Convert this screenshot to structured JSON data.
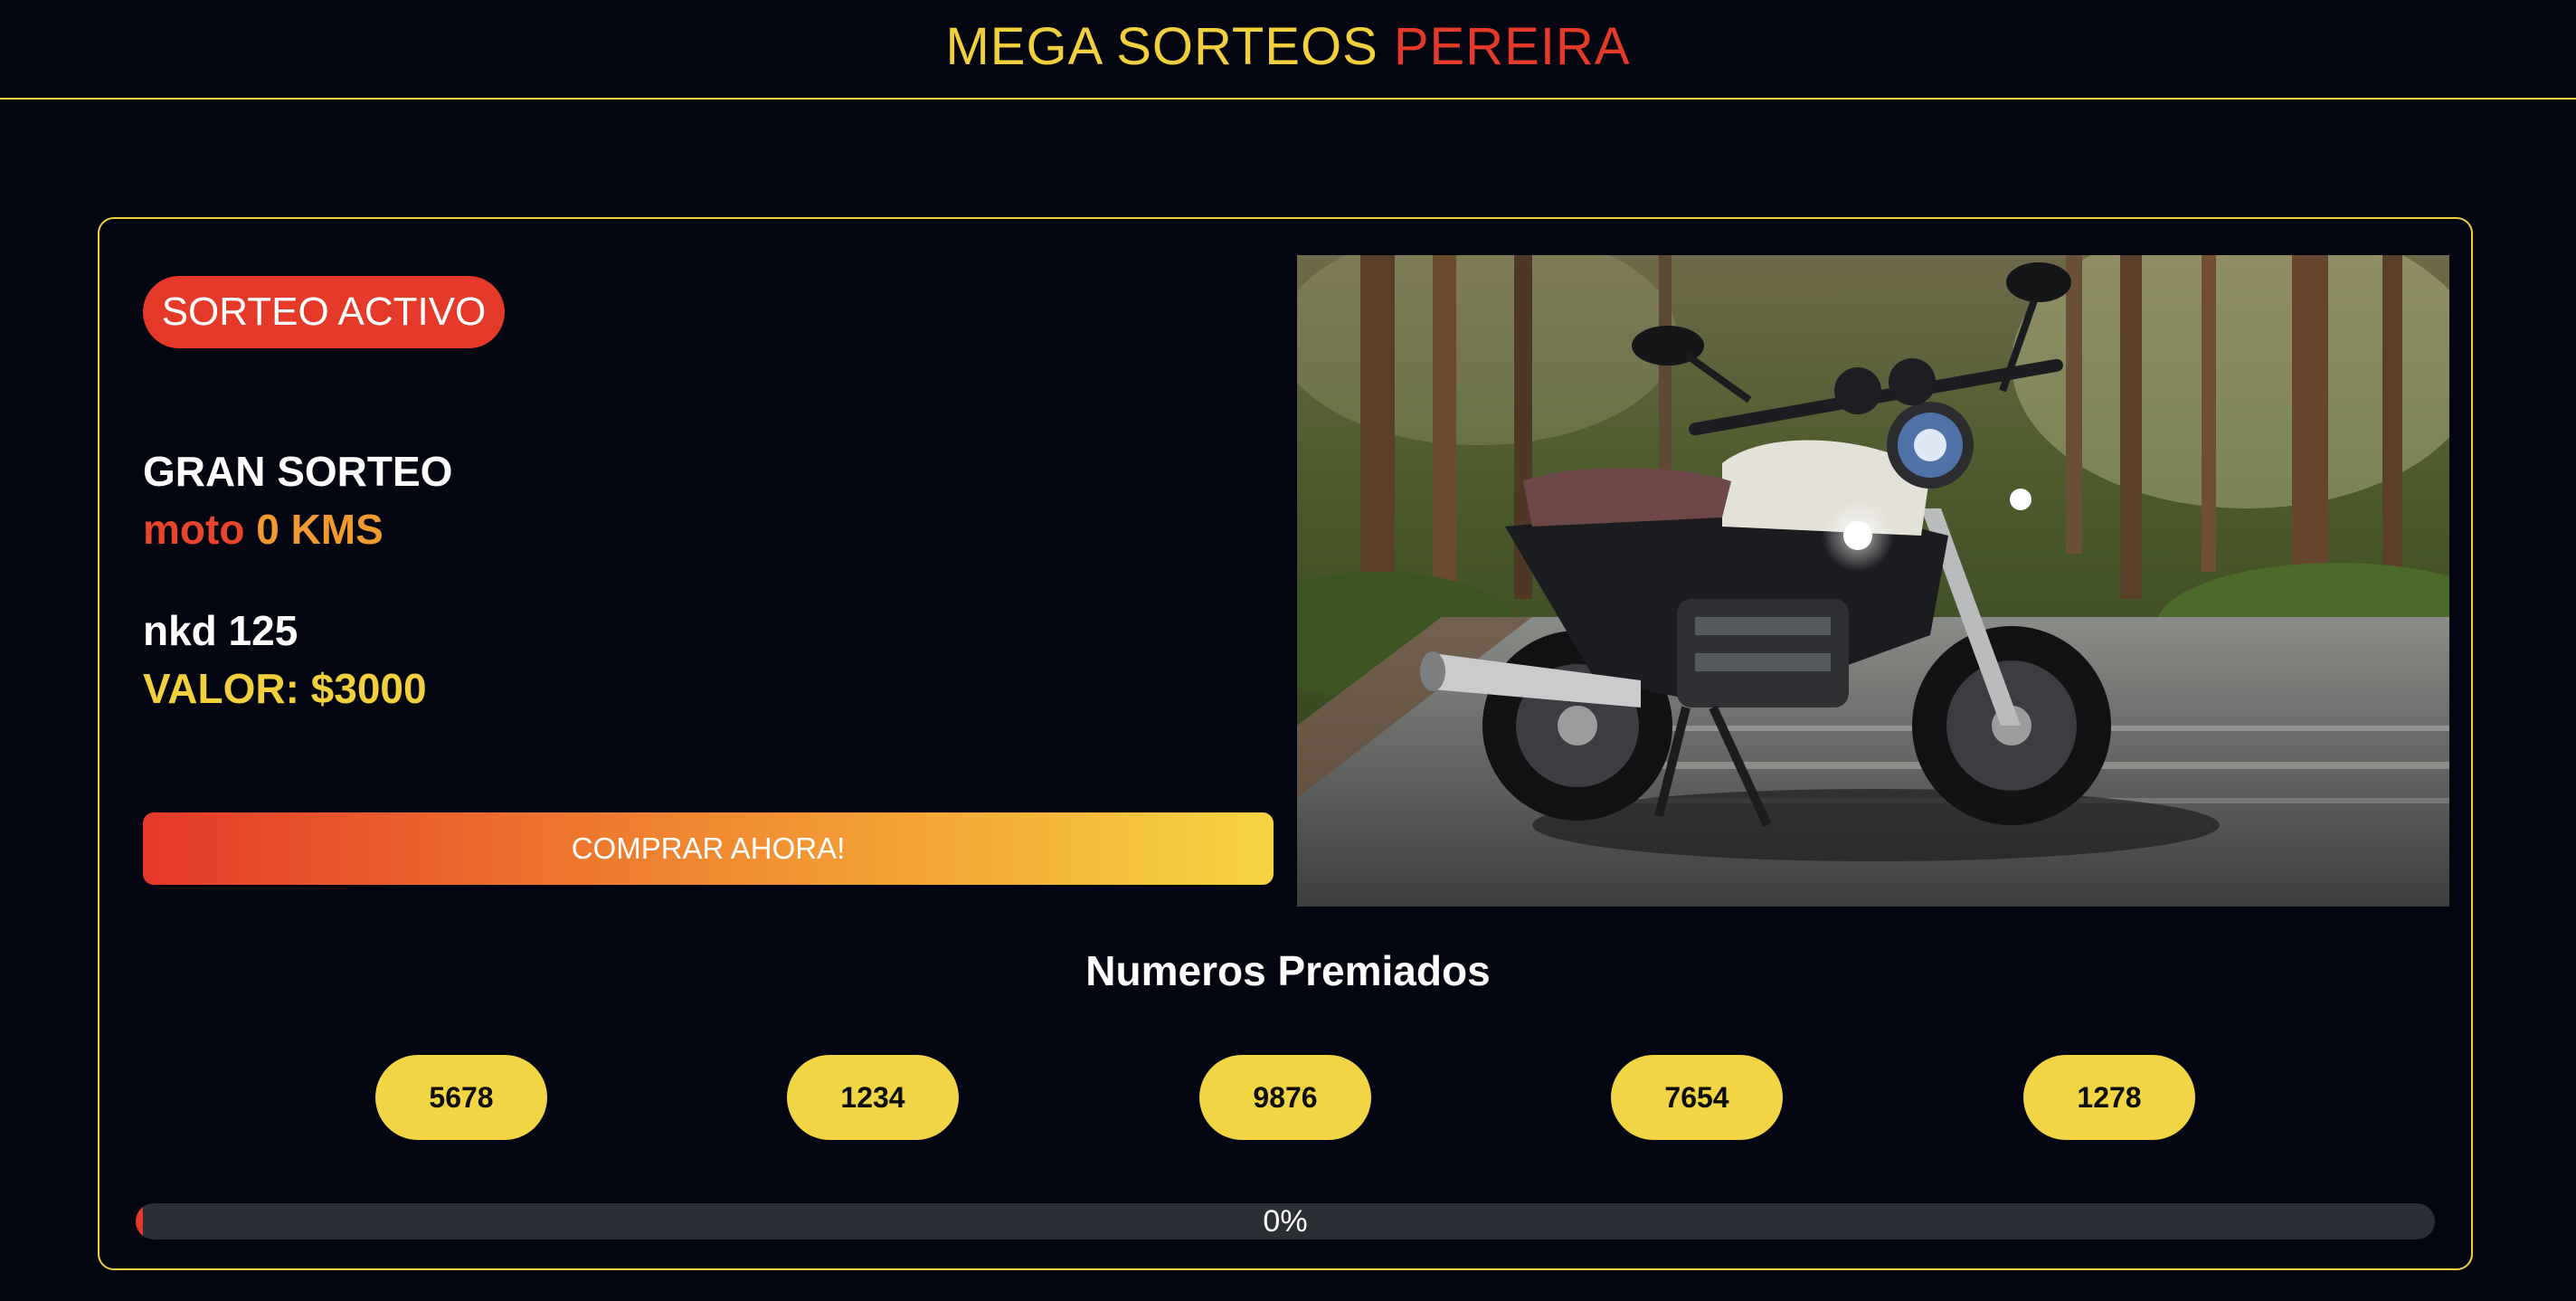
{
  "header": {
    "title_part1": "MEGA SORTEOS",
    "title_part2": "PEREIRA"
  },
  "raffle": {
    "status_badge": "SORTEO ACTIVO",
    "heading": "GRAN SORTEO",
    "prize_word1": "moto",
    "prize_word2": "0 KMS",
    "model": "nkd 125",
    "price": "VALOR: $3000",
    "buy_button_label": "COMPRAR AHORA!"
  },
  "winning_numbers": {
    "title": "Numeros Premiados",
    "numbers": [
      "5678",
      "1234",
      "9876",
      "7654",
      "1278"
    ]
  },
  "progress": {
    "percent": 0,
    "label": "0%"
  },
  "colors": {
    "background": "#030610",
    "accent_yellow": "#f2cf3c",
    "accent_red": "#e53a2a",
    "accent_orange": "#f29a30"
  },
  "images": {
    "prize_photo": "motorcycle-photo"
  }
}
